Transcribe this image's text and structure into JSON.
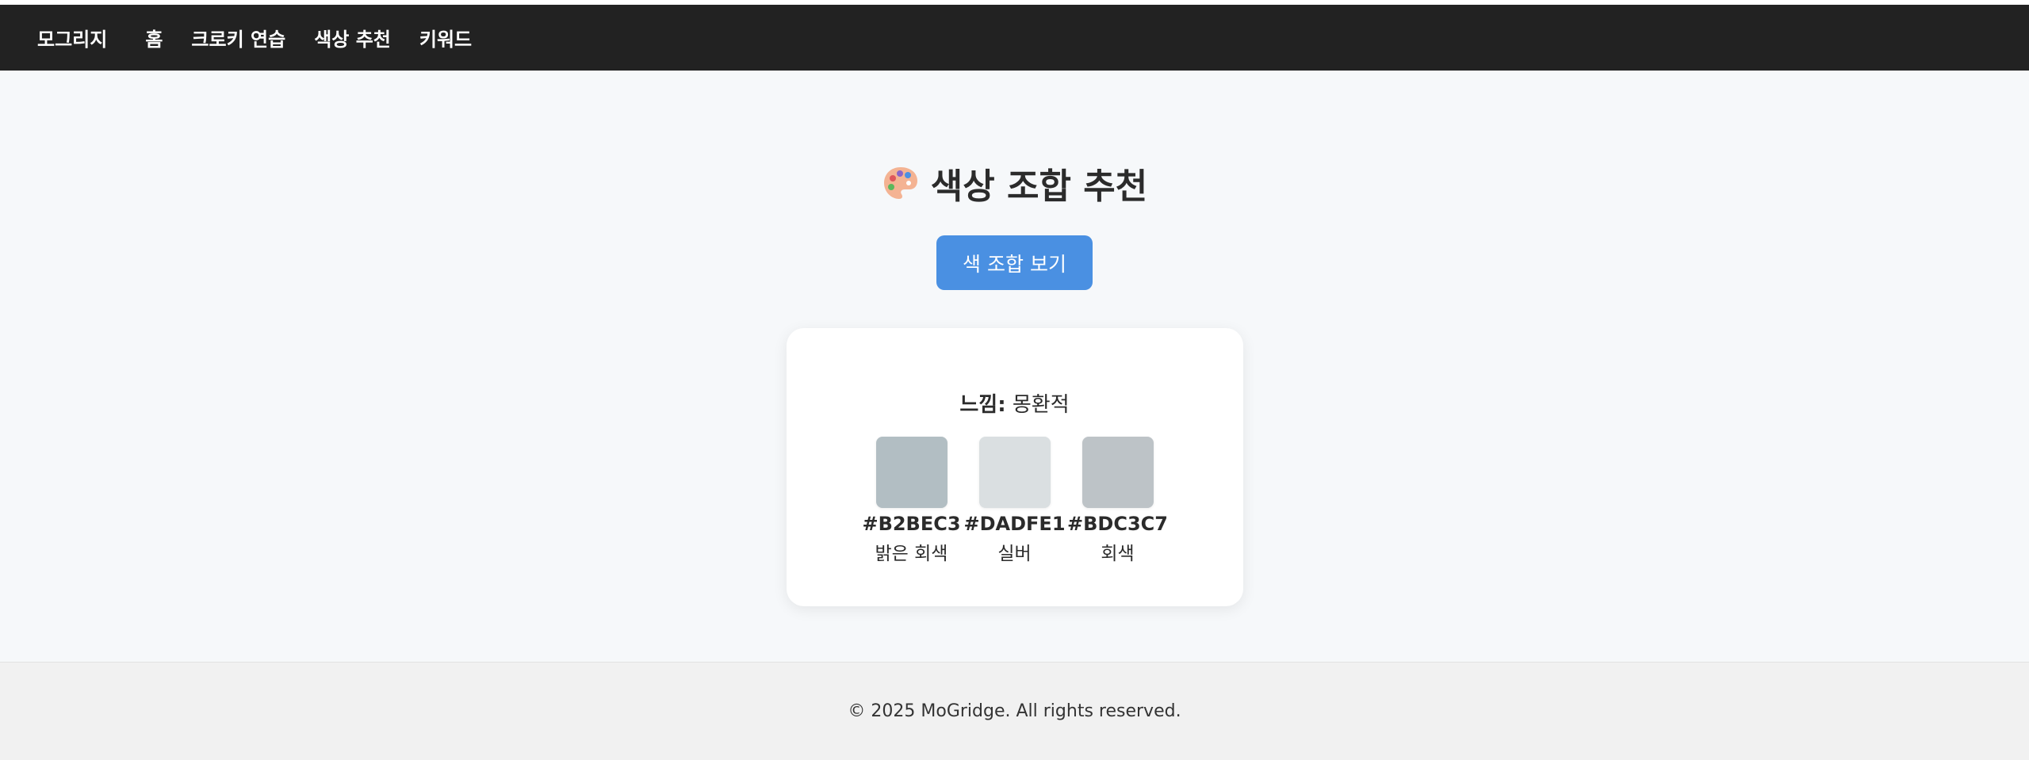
{
  "nav": {
    "brand": "모그리지",
    "links": [
      "홈",
      "크로키 연습",
      "색상 추천",
      "키워드"
    ]
  },
  "main": {
    "title": "색상 조합 추천",
    "icon": "palette-icon",
    "button_label": "색 조합 보기",
    "card": {
      "mood_label": "느낌:",
      "mood_value": " 몽환적",
      "swatches": [
        {
          "hex": "#B2BEC3",
          "name": "밝은 회색"
        },
        {
          "hex": "#DADFE1",
          "name": "실버"
        },
        {
          "hex": "#BDC3C7",
          "name": "회색"
        }
      ]
    }
  },
  "footer": {
    "text": "© 2025 MoGridge. All rights reserved."
  },
  "colors": {
    "navbar_bg": "#222222",
    "primary_button": "#4A90E2",
    "page_bg": "#F6F8FA",
    "footer_bg": "#F1F1F1"
  }
}
